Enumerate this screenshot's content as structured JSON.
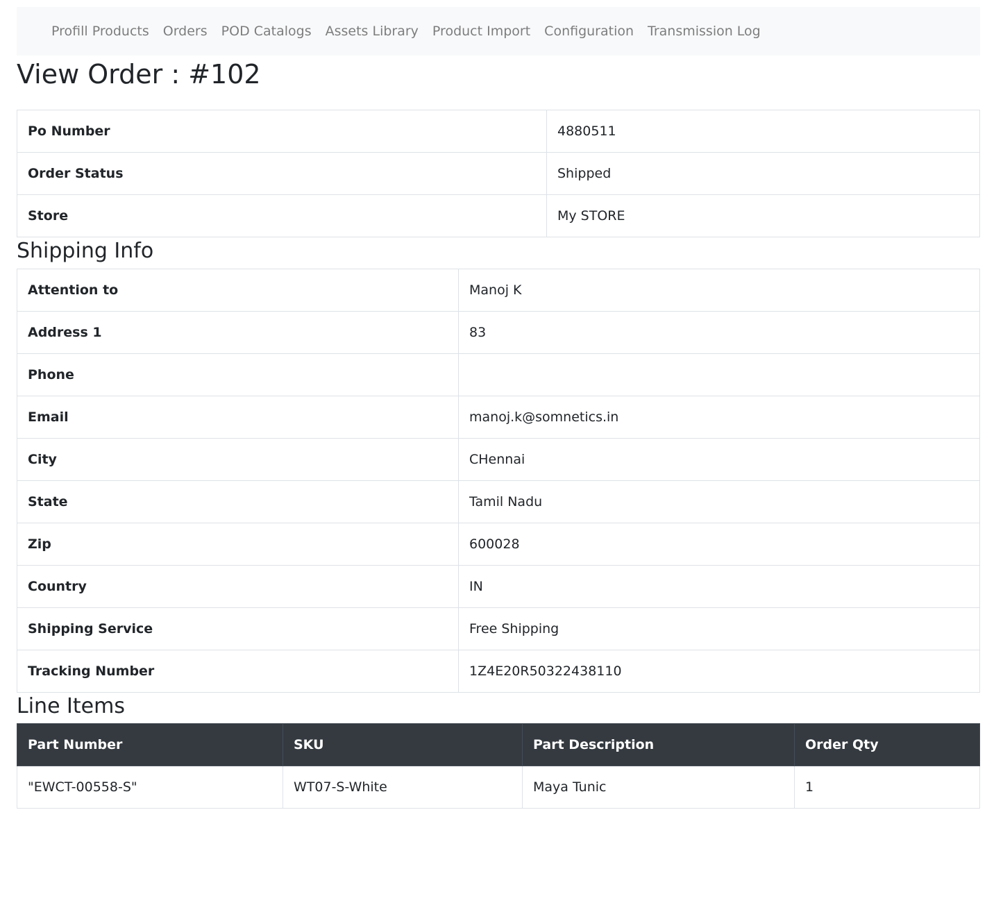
{
  "nav": {
    "items": [
      {
        "label": "Profill Products"
      },
      {
        "label": "Orders"
      },
      {
        "label": "POD Catalogs"
      },
      {
        "label": "Assets Library"
      },
      {
        "label": "Product Import"
      },
      {
        "label": "Configuration"
      },
      {
        "label": "Transmission Log"
      }
    ]
  },
  "page": {
    "title": "View Order : #102"
  },
  "order": {
    "rows": [
      {
        "label": "Po Number",
        "value": "4880511"
      },
      {
        "label": "Order Status",
        "value": "Shipped"
      },
      {
        "label": "Store",
        "value": "My STORE"
      }
    ]
  },
  "shipping": {
    "title": "Shipping Info",
    "rows": [
      {
        "label": "Attention to",
        "value": "Manoj K"
      },
      {
        "label": "Address 1",
        "value": "83"
      },
      {
        "label": "Phone",
        "value": ""
      },
      {
        "label": "Email",
        "value": "manoj.k@somnetics.in"
      },
      {
        "label": "City",
        "value": "CHennai"
      },
      {
        "label": "State",
        "value": "Tamil Nadu"
      },
      {
        "label": "Zip",
        "value": "600028"
      },
      {
        "label": "Country",
        "value": "IN"
      },
      {
        "label": "Shipping Service",
        "value": "Free Shipping"
      },
      {
        "label": "Tracking Number",
        "value": "1Z4E20R50322438110"
      }
    ]
  },
  "line_items": {
    "title": "Line Items",
    "headers": [
      "Part Number",
      "SKU",
      "Part Description",
      "Order Qty"
    ],
    "rows": [
      [
        "\"EWCT-00558-S\"",
        "WT07-S-White",
        "Maya Tunic",
        "1"
      ]
    ]
  },
  "colors": {
    "navbar_bg": "#f8f9fa",
    "table_header_bg": "#343a40",
    "border": "#dee2e6"
  }
}
